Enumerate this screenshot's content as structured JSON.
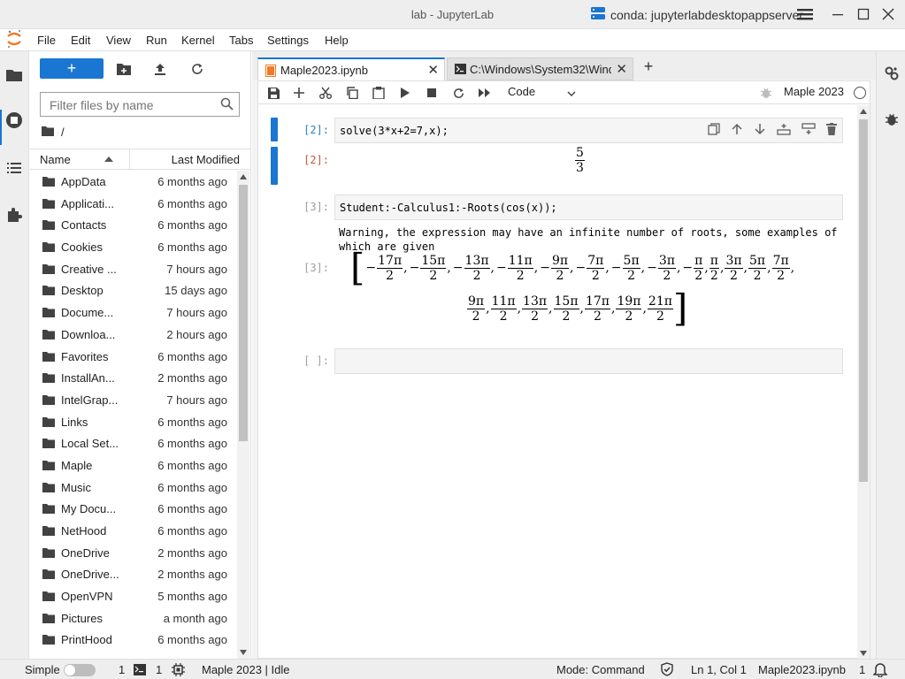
{
  "window": {
    "title": "lab - JupyterLab",
    "conda": "conda: jupyterlabdesktopappserver"
  },
  "menu": [
    "File",
    "Edit",
    "View",
    "Run",
    "Kernel",
    "Tabs",
    "Settings",
    "Help"
  ],
  "filebrowser": {
    "new_label": "+",
    "filter_placeholder": "Filter files by name",
    "path": "/",
    "col_name": "Name",
    "col_modified": "Last Modified",
    "files": [
      {
        "name": "AppData",
        "modified": "6 months ago"
      },
      {
        "name": "Applicati...",
        "modified": "6 months ago"
      },
      {
        "name": "Contacts",
        "modified": "6 months ago"
      },
      {
        "name": "Cookies",
        "modified": "6 months ago"
      },
      {
        "name": "Creative ...",
        "modified": "7 hours ago"
      },
      {
        "name": "Desktop",
        "modified": "15 days ago"
      },
      {
        "name": "Docume...",
        "modified": "7 hours ago"
      },
      {
        "name": "Downloa...",
        "modified": "2 hours ago"
      },
      {
        "name": "Favorites",
        "modified": "6 months ago"
      },
      {
        "name": "InstallAn...",
        "modified": "2 months ago"
      },
      {
        "name": "IntelGrap...",
        "modified": "7 hours ago"
      },
      {
        "name": "Links",
        "modified": "6 months ago"
      },
      {
        "name": "Local Set...",
        "modified": "6 months ago"
      },
      {
        "name": "Maple",
        "modified": "6 months ago"
      },
      {
        "name": "Music",
        "modified": "6 months ago"
      },
      {
        "name": "My Docu...",
        "modified": "6 months ago"
      },
      {
        "name": "NetHood",
        "modified": "6 months ago"
      },
      {
        "name": "OneDrive",
        "modified": "2 months ago"
      },
      {
        "name": "OneDrive...",
        "modified": "2 months ago"
      },
      {
        "name": "OpenVPN",
        "modified": "5 months ago"
      },
      {
        "name": "Pictures",
        "modified": "a month ago"
      },
      {
        "name": "PrintHood",
        "modified": "6 months ago"
      }
    ]
  },
  "tabs": [
    {
      "label": "Maple2023.ipynb",
      "close": "✕"
    },
    {
      "label": "C:\\Windows\\System32\\Wind",
      "close": "✕"
    }
  ],
  "notebook": {
    "cell_type": "Code",
    "kernel_name": "Maple 2023",
    "cells": [
      {
        "in_prompt": "[2]:",
        "code": "solve(3*x+2=7,x);",
        "out_prompt": "[2]:",
        "result": {
          "num": "5",
          "den": "3"
        }
      },
      {
        "in_prompt": "[3]:",
        "code": "Student:-Calculus1:-Roots(cos(x));",
        "out_prompt": "[3]:",
        "warning": "Warning, the expression may have an infinite number of roots, some examples of which are given",
        "row1": [
          {
            "sign": "−",
            "num": "17π",
            "den": "2"
          },
          {
            "sign": "−",
            "num": "15π",
            "den": "2"
          },
          {
            "sign": "−",
            "num": "13π",
            "den": "2"
          },
          {
            "sign": "−",
            "num": "11π",
            "den": "2"
          },
          {
            "sign": "−",
            "num": "9π",
            "den": "2"
          },
          {
            "sign": "−",
            "num": "7π",
            "den": "2"
          },
          {
            "sign": "−",
            "num": "5π",
            "den": "2"
          },
          {
            "sign": "−",
            "num": "3π",
            "den": "2"
          },
          {
            "sign": "−",
            "num": "π",
            "den": "2"
          },
          {
            "sign": "",
            "num": "π",
            "den": "2"
          },
          {
            "sign": "",
            "num": "3π",
            "den": "2"
          },
          {
            "sign": "",
            "num": "5π",
            "den": "2"
          },
          {
            "sign": "",
            "num": "7π",
            "den": "2"
          }
        ],
        "row2": [
          {
            "sign": "",
            "num": "9π",
            "den": "2"
          },
          {
            "sign": "",
            "num": "11π",
            "den": "2"
          },
          {
            "sign": "",
            "num": "13π",
            "den": "2"
          },
          {
            "sign": "",
            "num": "15π",
            "den": "2"
          },
          {
            "sign": "",
            "num": "17π",
            "den": "2"
          },
          {
            "sign": "",
            "num": "19π",
            "den": "2"
          },
          {
            "sign": "",
            "num": "21π",
            "den": "2"
          }
        ]
      },
      {
        "in_prompt": "[ ]:",
        "code": ""
      }
    ]
  },
  "statusbar": {
    "mode_label": "Simple",
    "terminals": "1",
    "kernels": "1",
    "kernel_status": "Maple 2023 | Idle",
    "mode": "Mode: Command",
    "cursor": "Ln 1, Col 1",
    "filename": "Maple2023.ipynb",
    "notifications": "1"
  }
}
